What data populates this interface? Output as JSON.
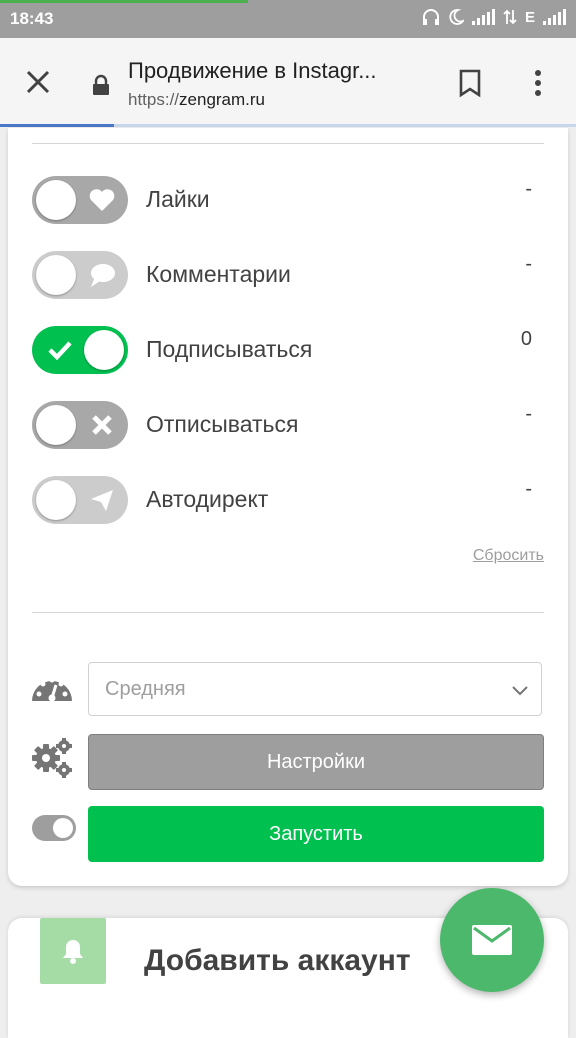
{
  "status_bar": {
    "time": "18:43",
    "network_label": "E",
    "icons": [
      "headphones-icon",
      "moon-icon",
      "signal-icon",
      "data-arrows-icon",
      "signal-icon"
    ]
  },
  "browser": {
    "page_title": "Продвижение в Instagr...",
    "url_scheme": "https://",
    "url_host": "zengram.ru"
  },
  "actions": [
    {
      "label": "Лайки",
      "count": "-",
      "enabled": false,
      "icon": "heart-icon",
      "style": "dark"
    },
    {
      "label": "Комментарии",
      "count": "-",
      "enabled": false,
      "icon": "comment-icon",
      "style": "light"
    },
    {
      "label": "Подписываться",
      "count": "0",
      "enabled": true,
      "icon": "check-icon",
      "style": "on"
    },
    {
      "label": "Отписываться",
      "count": "-",
      "enabled": false,
      "icon": "cross-icon",
      "style": "dark"
    },
    {
      "label": "Автодирект",
      "count": "-",
      "enabled": false,
      "icon": "send-icon",
      "style": "light"
    }
  ],
  "reset_label": "Сбросить",
  "speed": {
    "selected": "Средняя"
  },
  "settings_label": "Настройки",
  "start_label": "Запустить",
  "add_account": {
    "title": "Добавить аккаунт"
  },
  "colors": {
    "accent_green": "#00c050",
    "fab_green": "#4cb86c",
    "toggle_gray": "#a8a8a8"
  }
}
